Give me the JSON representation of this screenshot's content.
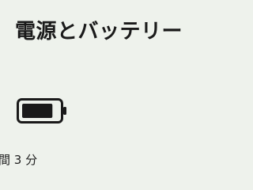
{
  "header": {
    "title": "電源とバッテリー"
  },
  "battery": {
    "icon": "battery-icon",
    "level_fraction": 0.85,
    "remaining_time": "間 3 分"
  },
  "colors": {
    "background": "#eef2ec",
    "battery_outline": "#1a1a1a",
    "battery_fill": "#1a1a1a"
  }
}
